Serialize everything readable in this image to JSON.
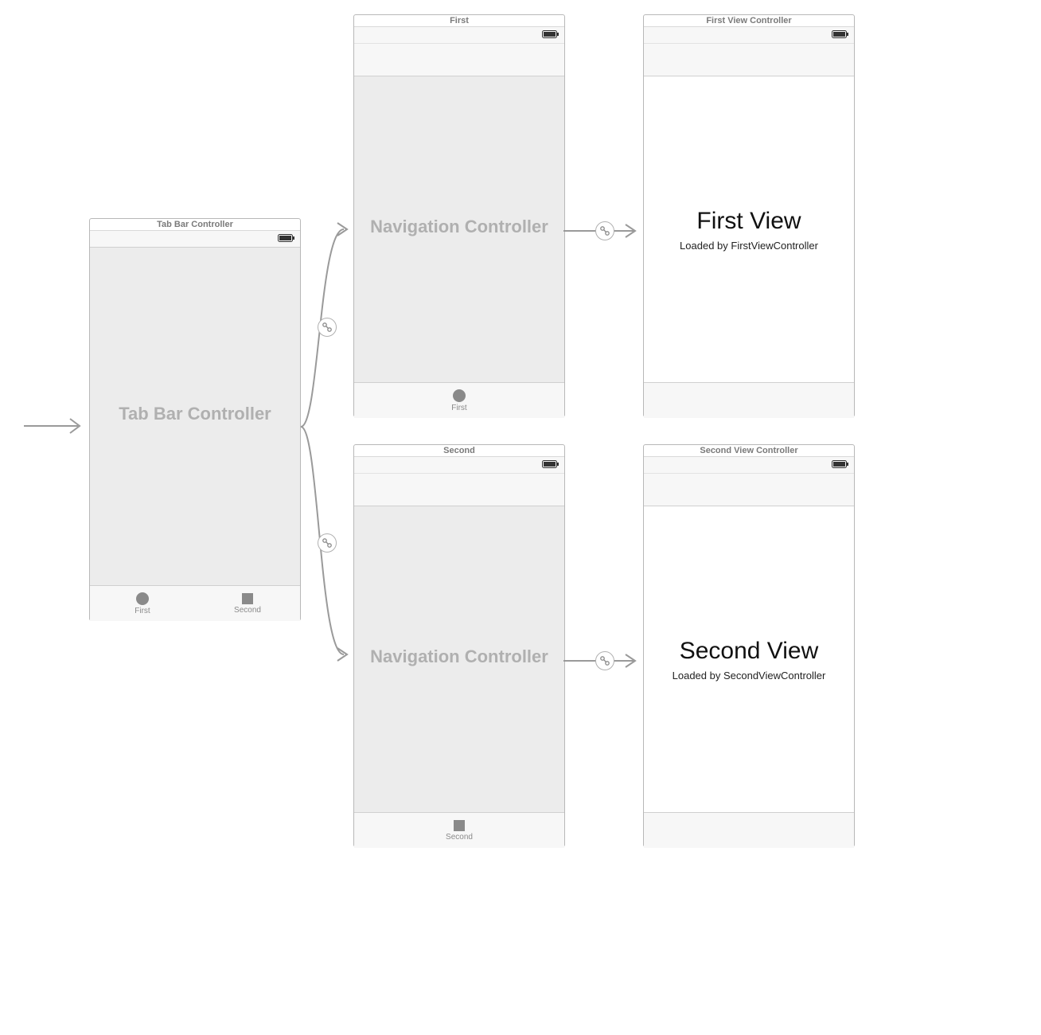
{
  "tabBar": {
    "title": "Tab Bar Controller",
    "placeholder": "Tab Bar Controller",
    "tabs": [
      {
        "label": "First",
        "icon": "circle"
      },
      {
        "label": "Second",
        "icon": "square"
      }
    ]
  },
  "nav1": {
    "title": "First",
    "placeholder": "Navigation Controller",
    "tab": {
      "label": "First",
      "icon": "circle"
    }
  },
  "nav2": {
    "title": "Second",
    "placeholder": "Navigation Controller",
    "tab": {
      "label": "Second",
      "icon": "square"
    }
  },
  "vc1": {
    "title": "First View Controller",
    "heading": "First View",
    "subtitle": "Loaded by FirstViewController"
  },
  "vc2": {
    "title": "Second View Controller",
    "heading": "Second View",
    "subtitle": "Loaded by SecondViewController"
  }
}
